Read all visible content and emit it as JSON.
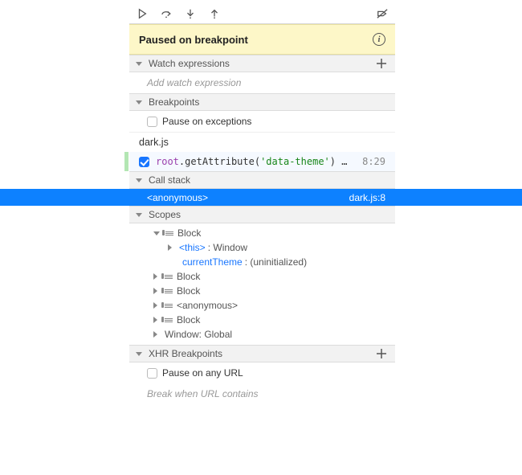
{
  "paused_text": "Paused on breakpoint",
  "sections": {
    "watch": {
      "title": "Watch expressions",
      "placeholder": "Add watch expression"
    },
    "breakpoints": {
      "title": "Breakpoints",
      "pause_exceptions_label": "Pause on exceptions",
      "file": "dark.js",
      "entry": {
        "obj": "root",
        "method": "getAttribute",
        "arg": "'data-theme'",
        "ell": " …",
        "pos": "8:29"
      }
    },
    "callstack": {
      "title": "Call stack",
      "frame_name": "<anonymous>",
      "frame_loc": "dark.js:8"
    },
    "scopes": {
      "title": "Scopes",
      "block_label": "Block",
      "this_label": "<this>",
      "this_value": ": Window",
      "var1_name": "currentTheme",
      "var1_value": ": (uninitialized)",
      "anon_label": "<anonymous>",
      "window_label": "Window: Global"
    },
    "xhr": {
      "title": "XHR Breakpoints",
      "pause_any_label": "Pause on any URL",
      "placeholder": "Break when URL contains"
    }
  }
}
